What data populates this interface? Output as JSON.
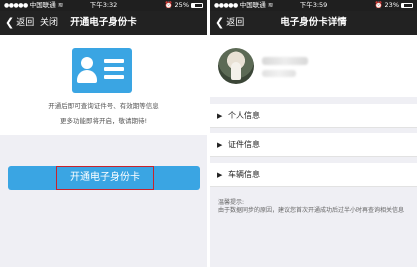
{
  "left": {
    "status": {
      "carrier": "中国联通",
      "time": "下午3:32",
      "battery": "25%"
    },
    "nav": {
      "back": "返回",
      "close": "关闭",
      "title": "开通电子身份卡"
    },
    "info_line1": "开通后即可查询证件号、有效期等信息",
    "info_line2": "更多功能即将开启，敬请期待!",
    "open_button": "开通电子身份卡"
  },
  "right": {
    "status": {
      "carrier": "中国联通",
      "time": "下午3:59",
      "battery": "23%"
    },
    "nav": {
      "back": "返回",
      "title": "电子身份卡详情"
    },
    "rows": [
      {
        "label": "个人信息"
      },
      {
        "label": "证件信息"
      },
      {
        "label": "车辆信息"
      }
    ],
    "tips_title": "温馨提示:",
    "tips_text": "由于数据同步的原因，建议您首次开通成功后过半小时再查询相关信息"
  },
  "icons": [
    "back-chevron-icon",
    "id-card-icon",
    "disclosure-triangle-icon",
    "wifi-icon",
    "battery-icon",
    "alarm-icon"
  ]
}
